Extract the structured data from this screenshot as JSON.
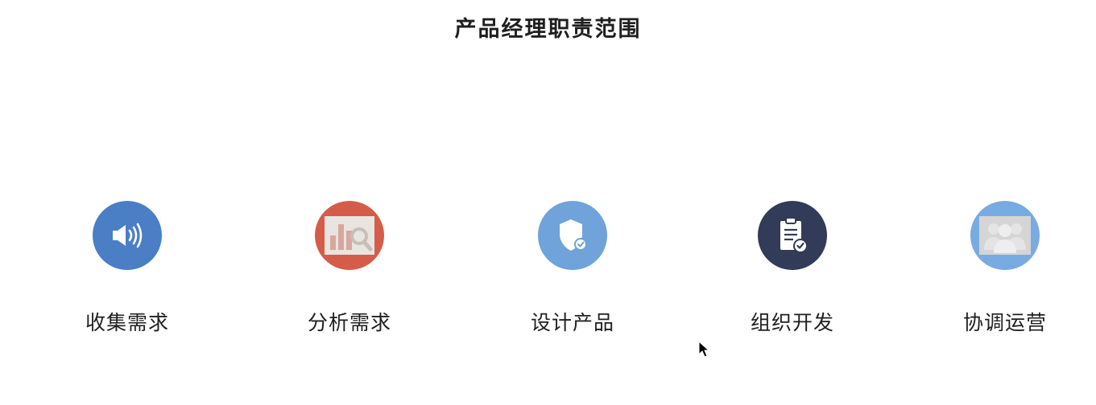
{
  "title": "产品经理职责范围",
  "steps": [
    {
      "label": "收集需求",
      "icon": "megaphone-icon",
      "color": "#4a7ec5"
    },
    {
      "label": "分析需求",
      "icon": "chart-magnifier-icon",
      "color": "#d65c4a"
    },
    {
      "label": "设计产品",
      "icon": "shield-check-icon",
      "color": "#6fa3da"
    },
    {
      "label": "组织开发",
      "icon": "clipboard-check-icon",
      "color": "#323b58"
    },
    {
      "label": "协调运营",
      "icon": "team-icon",
      "color": "#78abe2"
    }
  ]
}
